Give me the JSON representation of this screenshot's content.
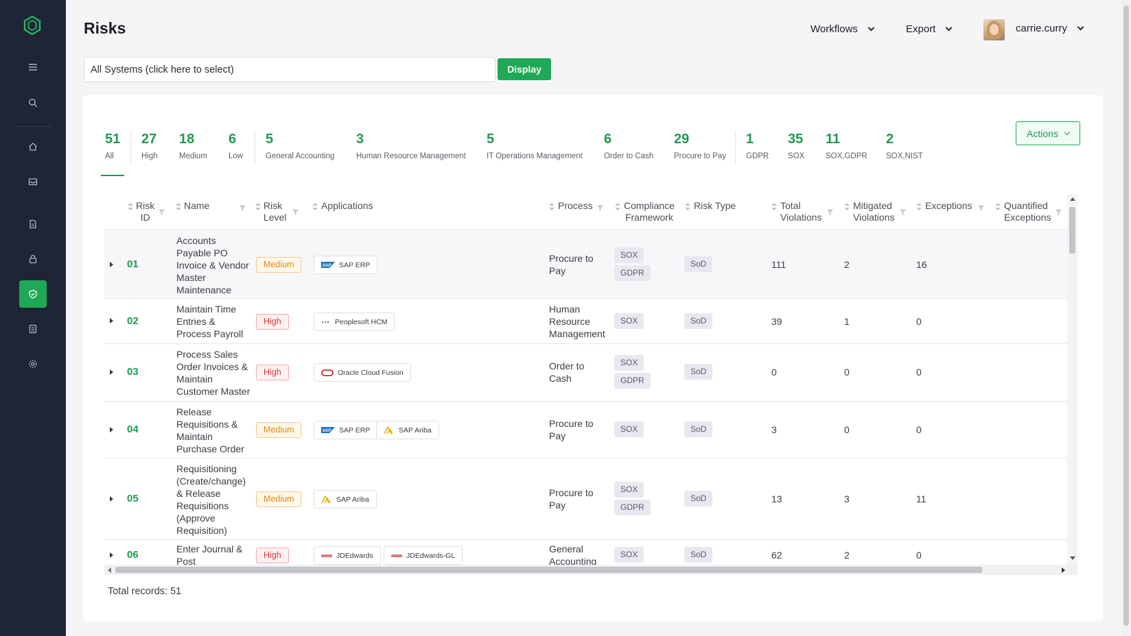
{
  "header": {
    "title": "Risks",
    "workflows_label": "Workflows",
    "export_label": "Export",
    "user_name": "carrie.curry"
  },
  "filter": {
    "systems_value": "All Systems (click here to select)",
    "display_label": "Display"
  },
  "stats": [
    {
      "value": "51",
      "label": "All"
    },
    {
      "value": "27",
      "label": "High"
    },
    {
      "value": "18",
      "label": "Medium"
    },
    {
      "value": "6",
      "label": "Low"
    },
    {
      "value": "5",
      "label": "General Accounting"
    },
    {
      "value": "3",
      "label": "Human Resource Management"
    },
    {
      "value": "5",
      "label": "IT Operations Management"
    },
    {
      "value": "6",
      "label": "Order to Cash"
    },
    {
      "value": "29",
      "label": "Procure to Pay"
    },
    {
      "value": "1",
      "label": "GDPR"
    },
    {
      "value": "35",
      "label": "SOX"
    },
    {
      "value": "11",
      "label": "SOX,GDPR"
    },
    {
      "value": "2",
      "label": "SOX,NIST"
    }
  ],
  "actions_label": "Actions",
  "columns": {
    "risk_id": [
      "Risk",
      "ID"
    ],
    "name": "Name",
    "risk_level": [
      "Risk",
      "Level"
    ],
    "applications": "Applications",
    "process": "Process",
    "compliance": [
      "Compliance",
      "Framework"
    ],
    "risk_type": "Risk Type",
    "total_violations": [
      "Total",
      "Violations"
    ],
    "mitigated_violations": [
      "Mitigated",
      "Violations"
    ],
    "exceptions": "Exceptions",
    "quantified_exceptions": [
      "Quantified",
      "Exceptions"
    ]
  },
  "rows": [
    {
      "id": "01",
      "name": [
        "Accounts",
        "Payable PO",
        "Invoice & Vendor",
        "Master",
        "Maintenance"
      ],
      "level": "Medium",
      "apps": [
        "SAP ERP"
      ],
      "process": [
        "Procure to",
        "Pay"
      ],
      "compliance": [
        "SOX",
        "GDPR"
      ],
      "risk_type": "SoD",
      "total": "111",
      "mitigated": "2",
      "exceptions": "16"
    },
    {
      "id": "02",
      "name": [
        "Maintain Time",
        "Entries &",
        "Process Payroll"
      ],
      "level": "High",
      "apps": [
        "Peoplesoft HCM"
      ],
      "process": [
        "Human",
        "Resource",
        "Management"
      ],
      "compliance": [
        "SOX"
      ],
      "risk_type": "SoD",
      "total": "39",
      "mitigated": "1",
      "exceptions": "0"
    },
    {
      "id": "03",
      "name": [
        "Process Sales",
        "Order Invoices &",
        "Maintain",
        "Customer Master"
      ],
      "level": "High",
      "apps": [
        "Oracle Cloud Fusion"
      ],
      "process": [
        "Order to",
        "Cash"
      ],
      "compliance": [
        "SOX",
        "GDPR"
      ],
      "risk_type": "SoD",
      "total": "0",
      "mitigated": "0",
      "exceptions": "0"
    },
    {
      "id": "04",
      "name": [
        "Release",
        "Requisitions &",
        "Maintain",
        "Purchase Order"
      ],
      "level": "Medium",
      "apps": [
        "SAP ERP",
        "SAP Ariba"
      ],
      "process": [
        "Procure to",
        "Pay"
      ],
      "compliance": [
        "SOX"
      ],
      "risk_type": "SoD",
      "total": "3",
      "mitigated": "0",
      "exceptions": "0"
    },
    {
      "id": "05",
      "name": [
        "Requisitioning",
        "(Create/change)",
        "& Release",
        "Requisitions",
        "(Approve",
        "Requisition)"
      ],
      "level": "Medium",
      "apps": [
        "SAP Ariba"
      ],
      "process": [
        "Procure to",
        "Pay"
      ],
      "compliance": [
        "SOX",
        "GDPR"
      ],
      "risk_type": "SoD",
      "total": "13",
      "mitigated": "3",
      "exceptions": "11"
    },
    {
      "id": "06",
      "name": [
        "Enter Journal &",
        "Post"
      ],
      "level": "High",
      "apps": [
        "JDEdwards",
        "JDEdwards-GL"
      ],
      "process": [
        "General",
        "Accounting"
      ],
      "compliance": [
        "SOX"
      ],
      "risk_type": "SoD",
      "total": "62",
      "mitigated": "2",
      "exceptions": "0"
    }
  ],
  "footer": {
    "total_records": "Total records: 51"
  },
  "colors": {
    "sidebar": "#1f2437",
    "accent": "#1fa855",
    "accent_text": "#1f9a52",
    "medium": "#e48a13",
    "high": "#d63a3a"
  },
  "icons": [
    "logo-icon",
    "menu-icon",
    "search-icon",
    "home-icon",
    "inbox-icon",
    "document-icon",
    "lock-icon",
    "shield-check-icon",
    "list-icon",
    "settings-icon",
    "filter-icon",
    "sort-icon"
  ]
}
